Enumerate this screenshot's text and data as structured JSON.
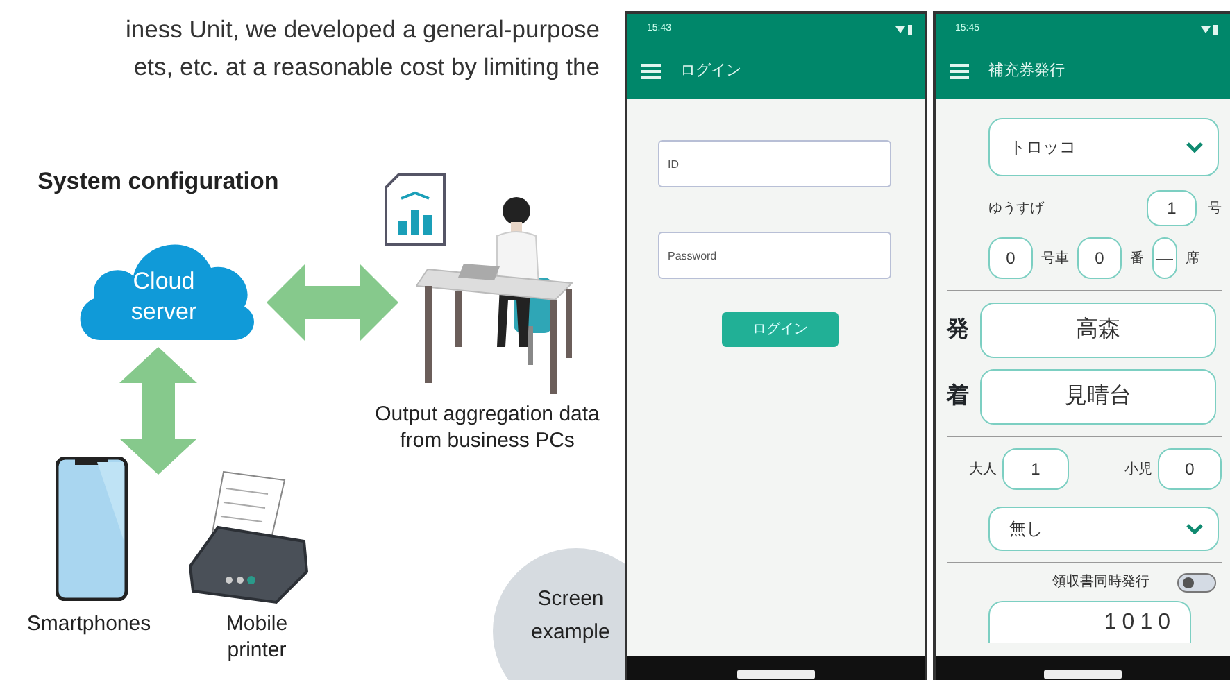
{
  "intro_text": [
    "iness Unit, we developed a general-purpose",
    "ets, etc. at a reasonable cost by limiting the"
  ],
  "diagram": {
    "title": "System configuration",
    "nodes": [
      {
        "kind": "cloud",
        "label": "Cloud server"
      },
      {
        "kind": "pc",
        "label": "Output aggregation data from business PCs"
      },
      {
        "kind": "phone",
        "label": "Smartphones"
      },
      {
        "kind": "printer",
        "label": "Mobile printer"
      }
    ],
    "badge": "Screen example"
  },
  "login_screen": {
    "time": "15:43",
    "title": "ログイン",
    "fields": [
      {
        "placeholder": "ID"
      },
      {
        "placeholder": "Password"
      }
    ],
    "button": "ログイン"
  },
  "ticket_screen": {
    "time": "15:45",
    "title": "補充券発行",
    "train_select": "トロッコ",
    "train_name": "ゆうすげ",
    "train_no": "1",
    "train_no_unit": "号",
    "car": "0",
    "car_unit": "号車",
    "seat_no": "0",
    "seat_no_unit": "番",
    "seat": "—",
    "seat_unit": "席",
    "from_label": "発",
    "from": "高森",
    "to_label": "着",
    "to": "見晴台",
    "adult_label": "大人",
    "adult": "1",
    "child_label": "小児",
    "child": "0",
    "discount_select": "無し",
    "receipt_label": "領収書同時発行",
    "receipt_on": false,
    "amount": "1010"
  }
}
